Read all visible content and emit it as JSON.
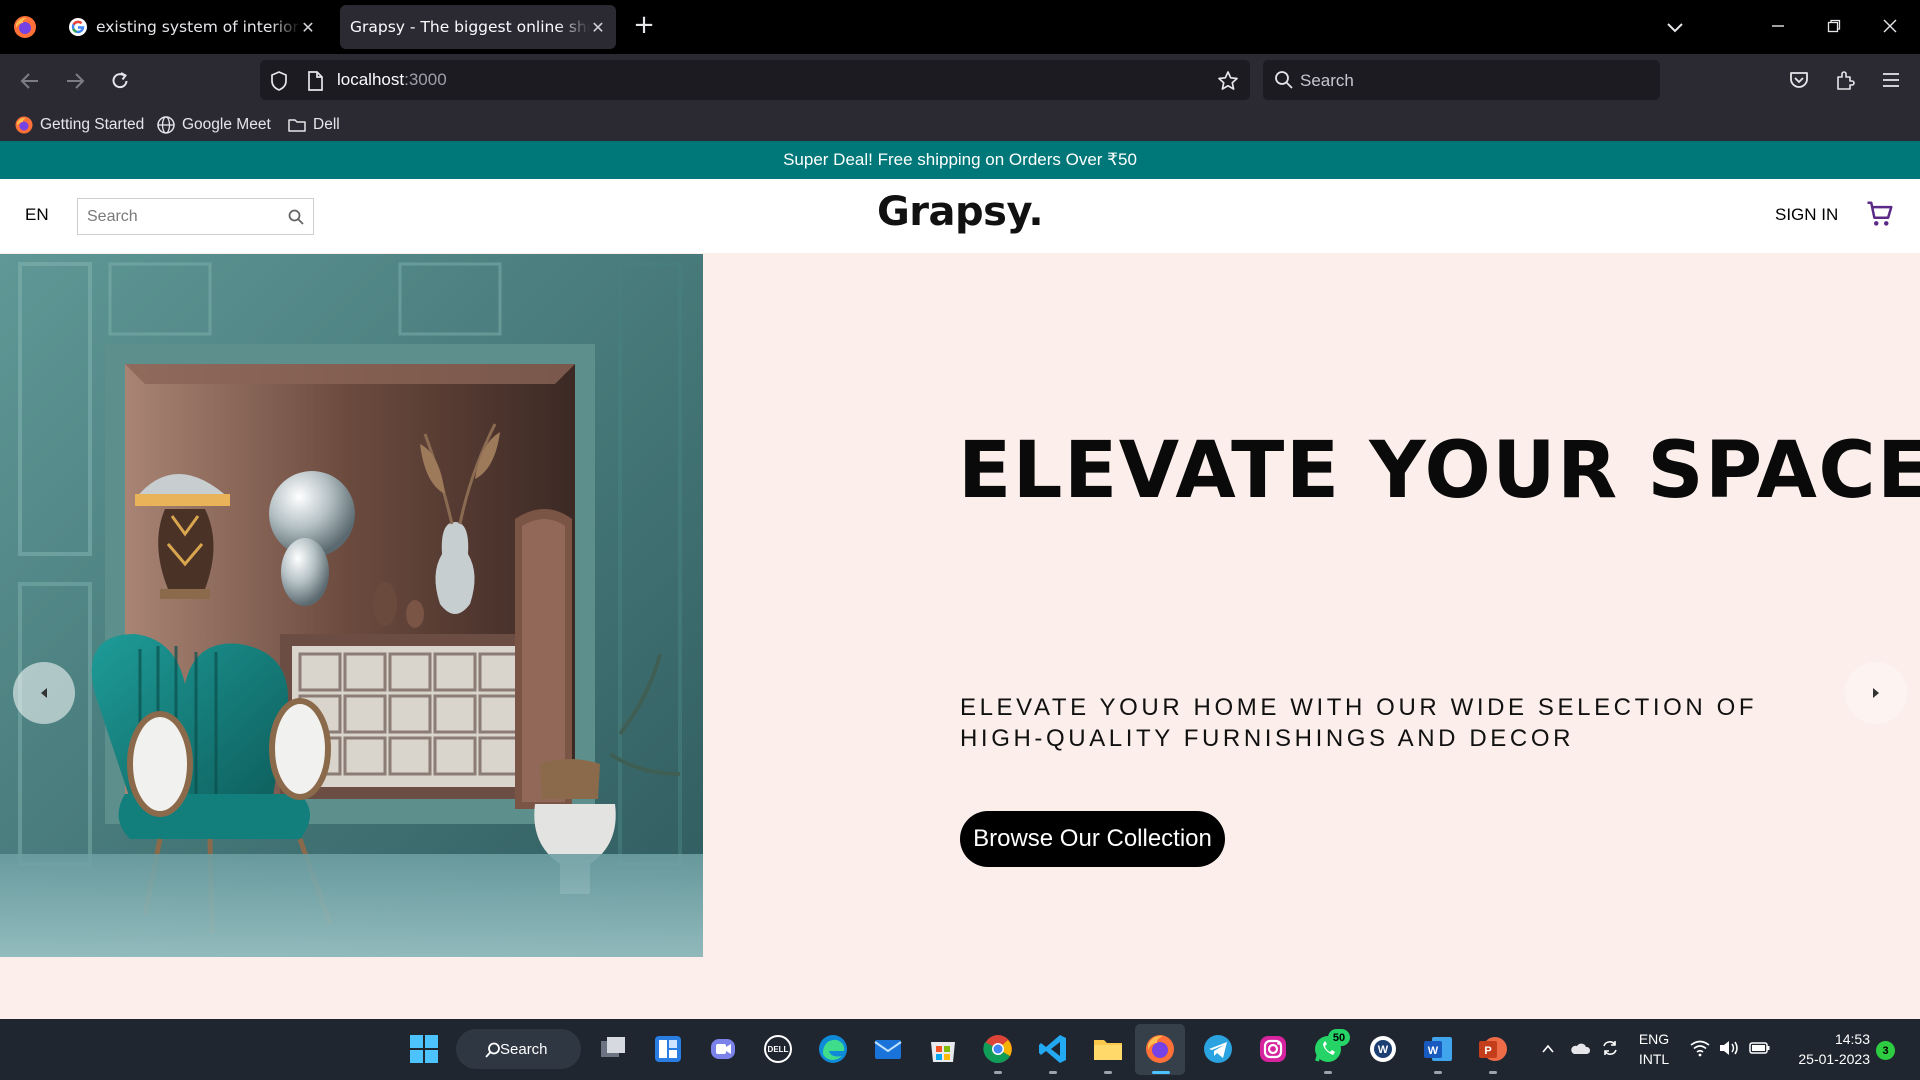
{
  "browser": {
    "tabs": [
      {
        "title": "existing system of interior ecom",
        "active": false
      },
      {
        "title": "Grapsy - The biggest online shopping",
        "active": true
      }
    ],
    "url": {
      "host": "localhost",
      "port": ":3000"
    },
    "search_placeholder": "Search",
    "bookmarks": [
      {
        "label": "Getting Started",
        "icon": "firefox-icon"
      },
      {
        "label": "Google Meet",
        "icon": "globe-icon"
      },
      {
        "label": "Dell",
        "icon": "folder-icon"
      }
    ]
  },
  "site": {
    "promo": "Super Deal! Free shipping on Orders Over ₹50",
    "lang": "EN",
    "search_placeholder": "Search",
    "logo": "Grapsy.",
    "signin": "SIGN IN",
    "hero": {
      "title": "ELEVATE YOUR SPACE",
      "subtitle": "ELEVATE YOUR HOME WITH OUR WIDE SELECTION OF HIGH-QUALITY FURNISHINGS AND DECOR",
      "cta": "Browse Our Collection"
    }
  },
  "taskbar": {
    "search_label": "Search",
    "whatsapp_badge": "50",
    "lang_line1": "ENG",
    "lang_line2": "INTL",
    "time": "14:53",
    "date": "25-01-2023",
    "notification_count": "3"
  },
  "colors": {
    "promo_bg": "#00787a",
    "hero_bg": "#fcefeb",
    "cta_bg": "#000000",
    "cart_icon": "#5b2a86"
  }
}
